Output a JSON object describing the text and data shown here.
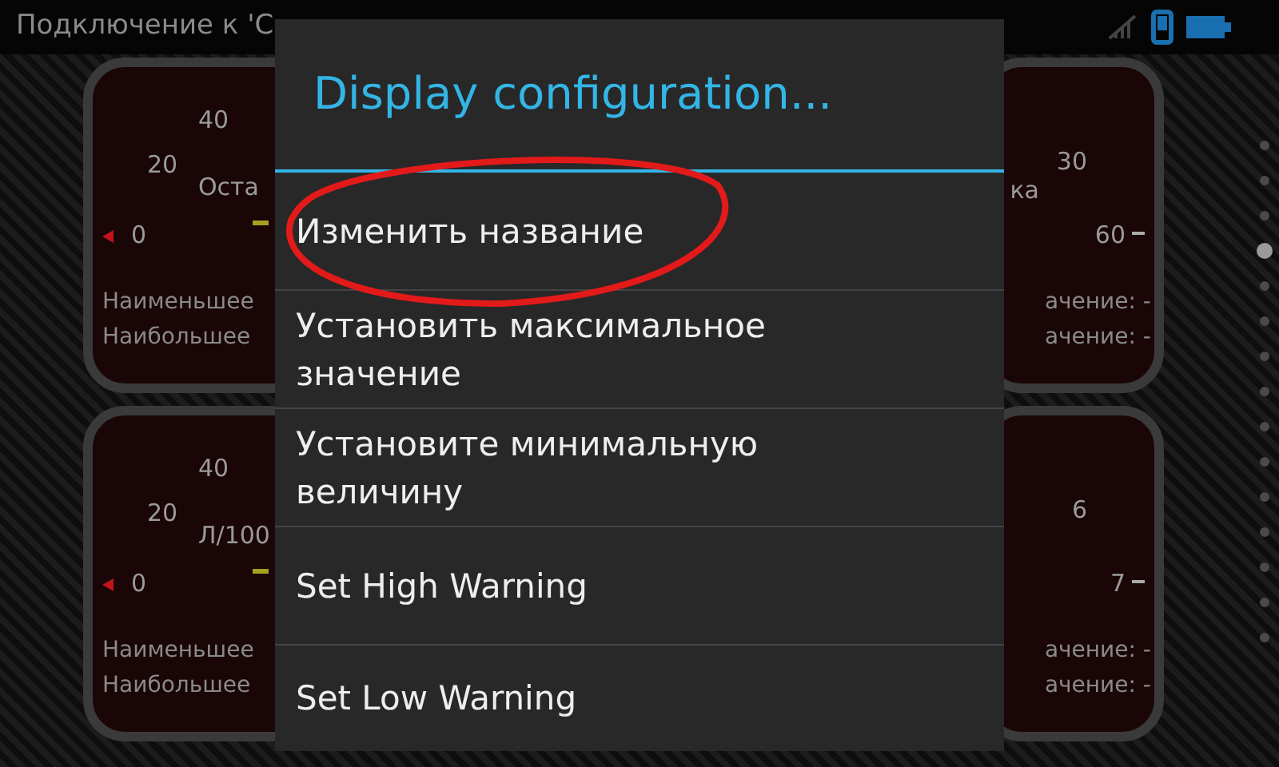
{
  "status_bar": {
    "title": "Подключение к 'С"
  },
  "left_gauges": [
    {
      "scale": [
        "0",
        "20",
        "40"
      ],
      "label": "Оста",
      "lines": [
        "Наименьшее",
        "Наибольшее"
      ]
    },
    {
      "scale": [
        "0",
        "20",
        "40"
      ],
      "label": "Л/100",
      "lines": [
        "Наименьшее",
        "Наибольшее"
      ]
    }
  ],
  "right_gauges": [
    {
      "scale": [
        "60",
        "30"
      ],
      "label": "ка",
      "lines": [
        "ачение: -",
        "ачение: -"
      ]
    },
    {
      "scale": [
        "7",
        "6"
      ],
      "lines": [
        "ачение: -",
        "ачение: -"
      ]
    }
  ],
  "dialog": {
    "title": "Display configuration...",
    "items": [
      {
        "label": "Изменить название",
        "circled": true
      },
      {
        "label": "Установить максимальное значение",
        "circled": false
      },
      {
        "label": "Установите минимальную величину",
        "circled": false
      },
      {
        "label": "Set High Warning",
        "circled": false
      },
      {
        "label": "Set Low Warning",
        "circled": false
      }
    ]
  },
  "pager": [
    {
      "selected": false
    },
    {
      "selected": false
    },
    {
      "selected": false
    },
    {
      "selected": true
    },
    {
      "selected": false
    },
    {
      "selected": false
    },
    {
      "selected": false
    },
    {
      "selected": false
    },
    {
      "selected": false
    },
    {
      "selected": false
    },
    {
      "selected": false
    },
    {
      "selected": false
    },
    {
      "selected": false
    },
    {
      "selected": false
    },
    {
      "selected": false
    }
  ]
}
